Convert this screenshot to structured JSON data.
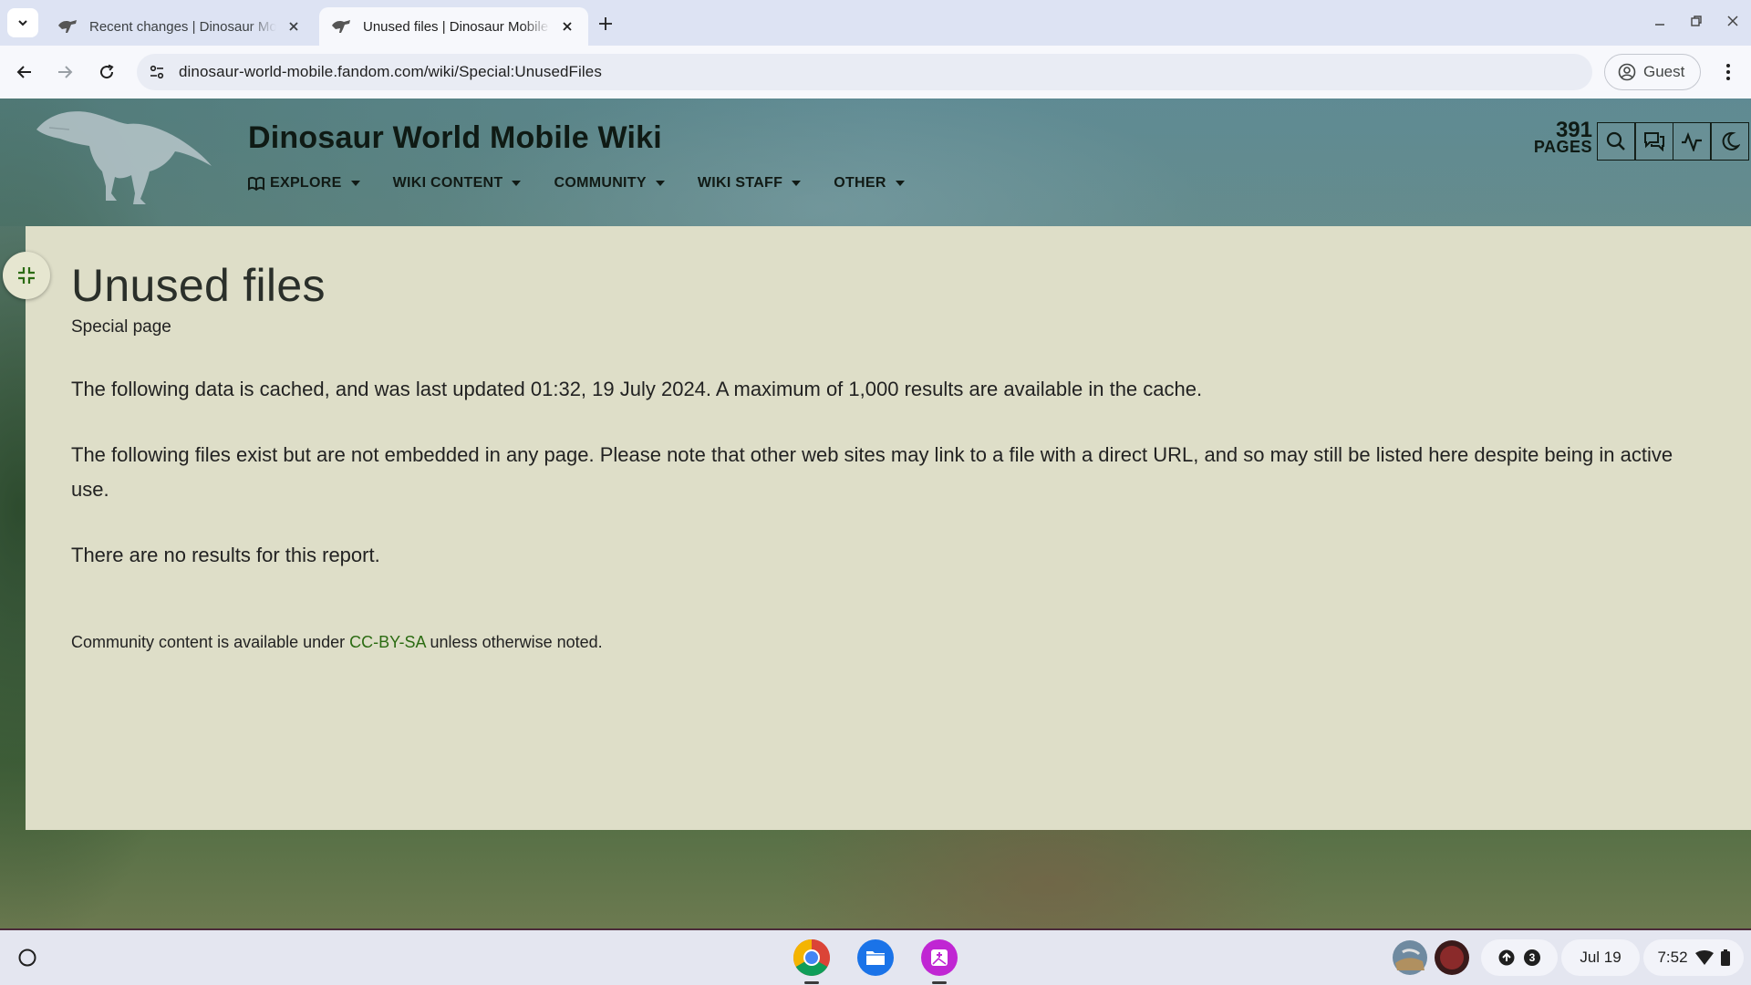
{
  "browser": {
    "tabs": [
      {
        "title": "Recent changes | Dinosaur Mobile Wiki",
        "active": false
      },
      {
        "title": "Unused files | Dinosaur Mobile Wiki",
        "active": true
      }
    ],
    "url": "dinosaur-world-mobile.fandom.com/wiki/Special:UnusedFiles",
    "profile_label": "Guest"
  },
  "wiki": {
    "name": "Dinosaur World Mobile Wiki",
    "nav": [
      "EXPLORE",
      "WIKI CONTENT",
      "COMMUNITY",
      "WIKI STAFF",
      "OTHER"
    ],
    "page_count": "391",
    "page_count_label": "PAGES"
  },
  "article": {
    "title": "Unused files",
    "subtitle": "Special page",
    "paragraphs": [
      "The following data is cached, and was last updated 01:32, 19 July 2024. A maximum of 1,000 results are available in the cache.",
      "The following files exist but are not embedded in any page. Please note that other web sites may link to a file with a direct URL, and so may still be listed here despite being in active use.",
      "There are no results for this report."
    ],
    "license_prefix": "Community content is available under ",
    "license_link": "CC-BY-SA",
    "license_suffix": " unless otherwise noted."
  },
  "shelf": {
    "apps": [
      "chrome-icon",
      "files-icon",
      "gallery-icon"
    ],
    "notification_count": "3",
    "date": "Jul 19",
    "time": "7:52"
  },
  "colors": {
    "card_bg": "#dedec8",
    "link": "#2b6b12",
    "heading": "#2a2f2a"
  }
}
